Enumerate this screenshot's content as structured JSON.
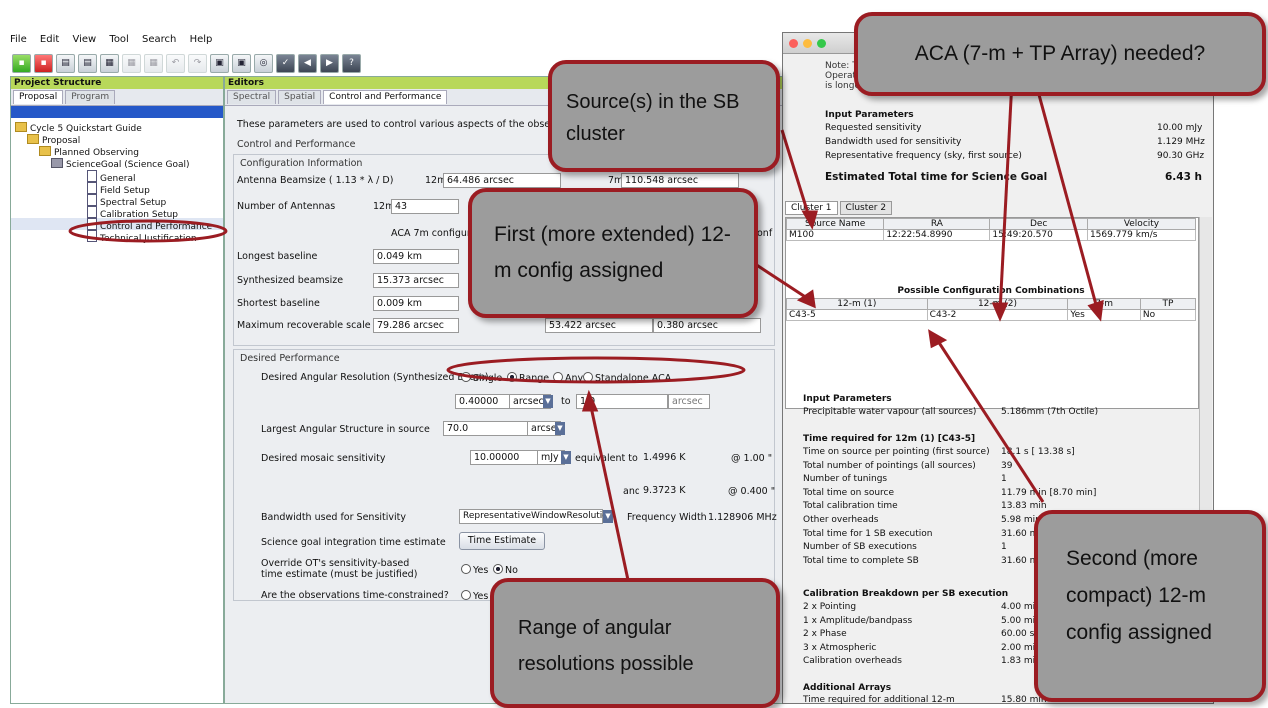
{
  "menu": [
    "File",
    "Edit",
    "View",
    "Tool",
    "Search",
    "Help"
  ],
  "toolbar_icons": [
    "new-icon",
    "open-icon",
    "save-icon",
    "save-as-icon",
    "cut-icon",
    "copy-icon",
    "paste-icon",
    "undo-icon",
    "redo-icon",
    "validate-icon",
    "submit-icon",
    "close-icon",
    "help-icon"
  ],
  "project": {
    "header": "Project Structure",
    "tabs": [
      "Proposal",
      "Program"
    ],
    "tree": [
      "Cycle 5 Quickstart Guide",
      "Proposal",
      "Planned Observing",
      "ScienceGoal (Science Goal)",
      "General",
      "Field Setup",
      "Spectral Setup",
      "Calibration Setup",
      "Control and Performance",
      "Technical Justification"
    ]
  },
  "editors": {
    "header": "Editors",
    "tabs": [
      "Spectral",
      "Spatial",
      "Control and Performance"
    ],
    "intro": "These parameters are used to control various aspects of the observations",
    "section": "Control and Performance",
    "config": {
      "legend": "Configuration Information",
      "beam_label": "Antenna Beamsize ( 1.13 * λ / D)",
      "beam_12m_tag": "12m",
      "beam_12m": "64.486 arcsec",
      "beam_7m_tag": "7m",
      "beam_7m": "110.548 arcsec",
      "nant_label": "Number of Antennas",
      "nant_tag": "12m",
      "nant_value": "43",
      "aca_col": "ACA 7m configurat",
      "aca_col_tail": "onf",
      "rows": [
        {
          "label": "Longest baseline",
          "v12": "0.049 km"
        },
        {
          "label": "Synthesized beamsize",
          "v12": "15.373 arcsec"
        },
        {
          "label": "Shortest baseline",
          "v12": "0.009 km"
        },
        {
          "label": "Maximum recoverable scale",
          "v12": "79.286 arcsec",
          "v7": "53.422 arcsec",
          "vtp": "0.380 arcsec"
        }
      ]
    },
    "perf": {
      "legend": "Desired Performance",
      "res_label": "Desired Angular Resolution (Synthesized Beam)",
      "res_opts": [
        "Single",
        "Range",
        "Any",
        "Standalone ACA"
      ],
      "res_from": "0.40000",
      "res_unit": "arcsec",
      "to": "to",
      "res_to": "1.0",
      "las_label": "Largest Angular Structure in source",
      "las_value": "70.0",
      "las_unit": "arcsec",
      "sens_label": "Desired mosaic sensitivity",
      "sens_value": "10.00000",
      "sens_unit": "mJy",
      "equiv": "equivalent to",
      "equiv_k1": "1.4996 K",
      "at1": "@ 1.00 \"",
      "and": "and",
      "equiv_k2": "9.3723 K",
      "at2": "@ 0.400 \"",
      "bw_label": "Bandwidth used for Sensitivity",
      "bw_value": "RepresentativeWindowResolution",
      "fw_label": "Frequency Width",
      "fw_value": "1.128906 MHz",
      "time_label": "Science goal integration time estimate",
      "time_button": "Time Estimate",
      "override_label1": "Override OT's sensitivity-based",
      "override_label2": "time estimate (must be justified)",
      "constrained_label": "Are the observations time-constrained?",
      "yes": "Yes",
      "no": "No"
    }
  },
  "popup": {
    "note1": "Note: T",
    "note2": "Operati",
    "note3": "is longer,",
    "input_title": "Input Parameters",
    "params": [
      {
        "k": "Requested sensitivity",
        "v": "10.00 mJy"
      },
      {
        "k": "Bandwidth used for sensitivity",
        "v": "1.129 MHz"
      },
      {
        "k": "Representative frequency (sky, first source)",
        "v": "90.30 GHz"
      }
    ],
    "total_label": "Estimated Total time for Science Goal",
    "total_value": "6.43 h",
    "tabs": [
      "Cluster 1",
      "Cluster 2"
    ],
    "src_headers": [
      "Source Name",
      "RA",
      "Dec",
      "Velocity"
    ],
    "src_row": [
      "M100",
      "12:22:54.8990",
      "15:49:20.570",
      "1569.779 km/s"
    ],
    "combo_title": "Possible Configuration Combinations",
    "combo_headers": [
      "12-m (1)",
      "12-m (2)",
      "7-m",
      "TP"
    ],
    "combo_row": [
      "C43-5",
      "C43-2",
      "Yes",
      "No"
    ],
    "input2_title": "Input Parameters",
    "pwv_label": "Precipitable water vapour (all sources)",
    "pwv_value": "5.186mm (7th Octile)",
    "time12_title": "Time required for 12m (1) [C43-5]",
    "time12": [
      {
        "k": "Time on source per pointing (first source)",
        "v": "18.1 s [ 13.38 s]"
      },
      {
        "k": "Total number of pointings (all sources)",
        "v": "39"
      },
      {
        "k": "Number of tunings",
        "v": "1"
      },
      {
        "k": "Total time on source",
        "v": "11.79 min [8.70 min]"
      },
      {
        "k": "Total calibration time",
        "v": "13.83 min"
      },
      {
        "k": "Other overheads",
        "v": "5.98 min"
      },
      {
        "k": "Total time for 1 SB execution",
        "v": "31.60 min"
      },
      {
        "k": "Number of SB executions",
        "v": "1"
      },
      {
        "k": "Total time to complete SB",
        "v": "31.60 min"
      }
    ],
    "calib_title": "Calibration Breakdown per SB execution",
    "calib": [
      {
        "k": "2 x Pointing",
        "v": "4.00 min"
      },
      {
        "k": "1 x Amplitude/bandpass",
        "v": "5.00 min"
      },
      {
        "k": "2 x Phase",
        "v": "60.00 s"
      },
      {
        "k": "3 x Atmospheric",
        "v": "2.00 min"
      },
      {
        "k": "Calibration overheads",
        "v": "1.83 min"
      }
    ],
    "add_title": "Additional Arrays",
    "add_label": "Time required for additional 12-m",
    "add_value": "15.80 min"
  },
  "callouts": {
    "aca": "ACA (7-m + TP Array) needed?",
    "source": "Source(s) in the SB cluster",
    "first": "First (more extended) 12-m config assigned",
    "second": "Second (more compact) 12-m config assigned",
    "range": "Range of angular resolutions possible"
  },
  "colors": {
    "callout_border": "#9b1c22",
    "callout_fill": "#9c9c9c",
    "arrow": "#9b1c22",
    "tree_selection": "#2558c8",
    "panel_header": "#b8d85a"
  }
}
